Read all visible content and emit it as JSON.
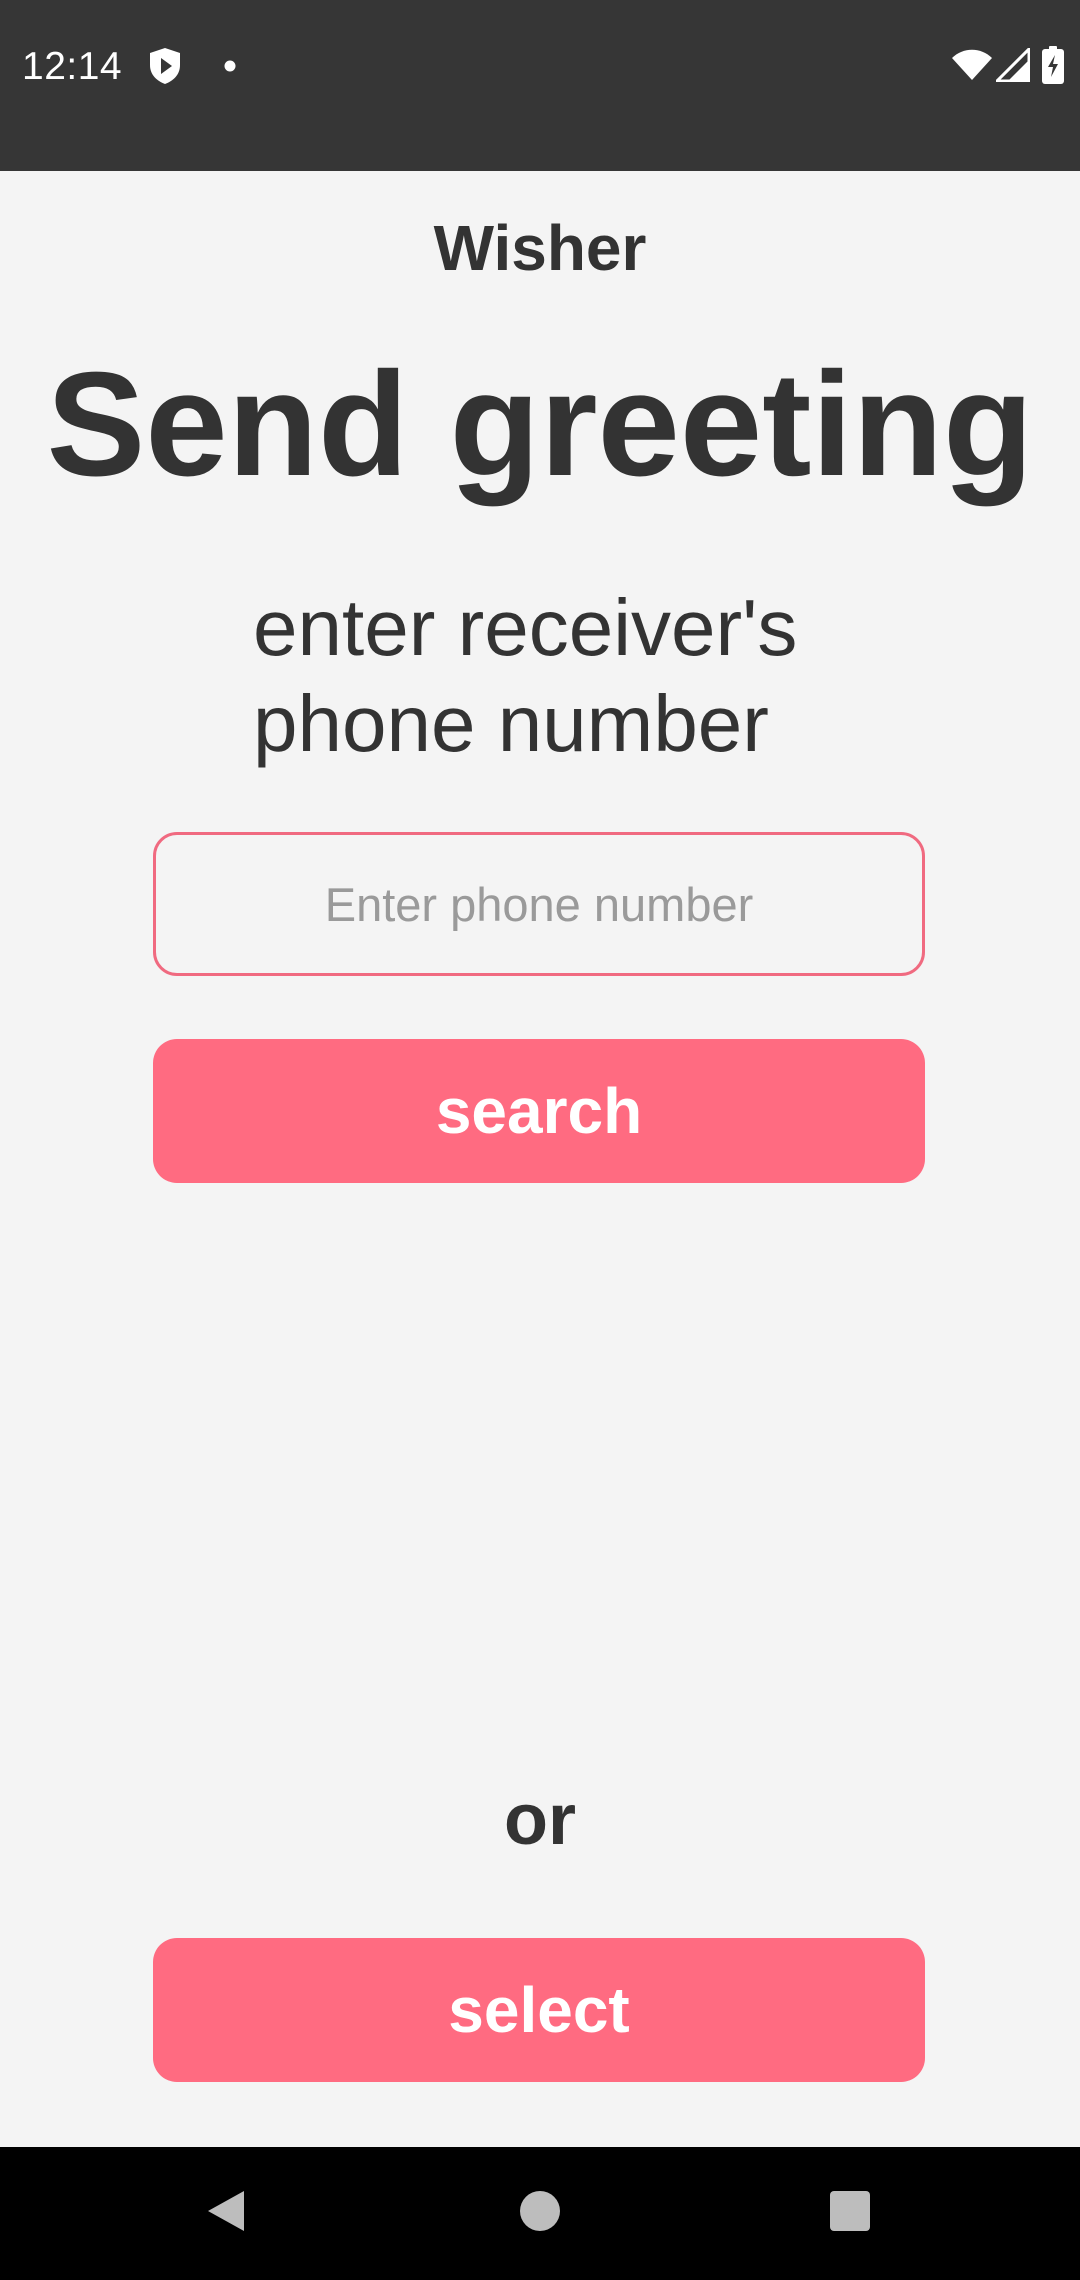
{
  "status_bar": {
    "time": "12:14",
    "left_icons": [
      "shield-play-icon",
      "notification-dot-icon"
    ],
    "right_icons": [
      "wifi-icon",
      "cell-signal-icon",
      "battery-charging-icon"
    ]
  },
  "header": {
    "app_name": "Wisher"
  },
  "main": {
    "title": "Send greeting",
    "prompt_line1": "enter receiver's",
    "prompt_line2": "phone number",
    "phone_input": {
      "value": "",
      "placeholder": "Enter phone number"
    },
    "search_label": "search",
    "or_label": "or",
    "select_label": "select"
  },
  "nav_bar": {
    "icons": [
      "back-icon",
      "home-icon",
      "recents-icon"
    ]
  },
  "colors": {
    "accent": "#ff6b81",
    "input_border": "#f06a80",
    "text": "#333333",
    "background": "#f4f4f4",
    "status_bar": "#363636"
  }
}
